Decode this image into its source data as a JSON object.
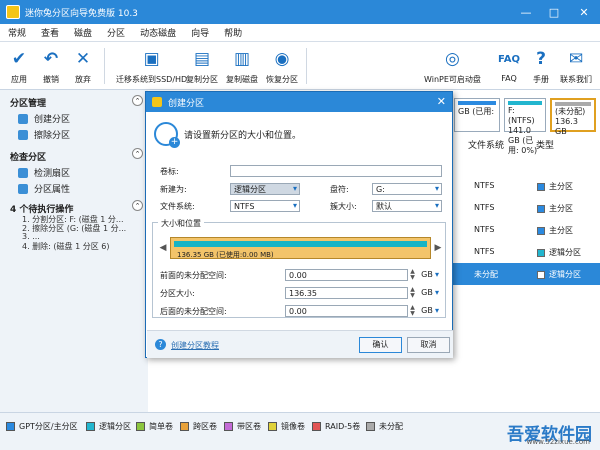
{
  "window": {
    "title": "迷你兔分区向导免费版 10.3",
    "minimize": "—",
    "maximize": "□",
    "close": "✕"
  },
  "menu": [
    "常规",
    "查看",
    "磁盘",
    "分区",
    "动态磁盘",
    "向导",
    "帮助"
  ],
  "toolbar": {
    "apply": "应用",
    "undo": "撤销",
    "discard": "放弃",
    "migrate": "迁移系统到SSD/HD",
    "copy_partition": "复制分区",
    "copy_disk": "复制磁盘",
    "recover_partition": "恢复分区",
    "winpe": "WinPE可启动盘",
    "faq": "FAQ",
    "manual": "手册",
    "contact": "联系我们"
  },
  "sidebar": {
    "partition_mgmt": "分区管理",
    "create_partition": "创建分区",
    "delete_partition": "擦除分区",
    "check_partition": "检查分区",
    "check_bad_sectors": "检测扇区",
    "partition_props": "分区属性",
    "pending": "4 个待执行操作",
    "ops": [
      "1. 分割分区: F: (磁盘 1 分...",
      "2. 擦除分区 (G: (磁盘 1 分...",
      "3. ...",
      "4. 删除: (磁盘 1 分区 6)"
    ]
  },
  "disk_map": {
    "f_label": "F: (NTFS)",
    "f_size": "141.0 GB (已用:",
    "f_used": "0%)",
    "un_label": "(未分配)",
    "un_size": "136.3 GB",
    "left_fragment": "GB (已用:"
  },
  "columns": {
    "fs": "文件系统",
    "type": "类型"
  },
  "rows": [
    {
      "fs": "NTFS",
      "type": "主分区",
      "color": "#2b8ae0"
    },
    {
      "fs": "NTFS",
      "type": "主分区",
      "color": "#2b8ae0"
    },
    {
      "fs": "NTFS",
      "type": "主分区",
      "color": "#2b8ae0"
    },
    {
      "fs": "NTFS",
      "type": "逻辑分区",
      "color": "#22b6cf"
    },
    {
      "fs": "未分配",
      "type": "逻辑分区",
      "color": "#2b8ae0"
    }
  ],
  "dialog": {
    "title": "创建分区",
    "heading": "请设置新分区的大小和位置。",
    "volume_label": "卷标:",
    "create_as": "新建为:",
    "create_as_value": "逻辑分区",
    "drive_letter": "盘符:",
    "drive_letter_value": "G:",
    "file_system": "文件系统:",
    "file_system_value": "NTFS",
    "cluster_size": "簇大小:",
    "cluster_size_value": "默认",
    "size_location": "大小和位置",
    "bar_text": "136.35 GB (已使用:0.00 MB)",
    "before_label": "前面的未分配空间:",
    "before_value": "0.00",
    "size_label": "分区大小:",
    "size_value": "136.35",
    "after_label": "后面的未分配空间:",
    "after_value": "0.00",
    "unit": "GB",
    "help_link": "创建分区教程",
    "ok": "确认",
    "cancel": "取消"
  },
  "legend": [
    "GPT分区/主分区",
    "逻辑分区",
    "简单卷",
    "跨区卷",
    "带区卷",
    "镜像卷",
    "RAID-5卷",
    "未分配"
  ],
  "legend_colors": [
    "#2b8ae0",
    "#22b6cf",
    "#8cc63f",
    "#e8a23a",
    "#c36bd6",
    "#e0d23a",
    "#e25555",
    "#aaaaaa"
  ],
  "watermark": {
    "brand": "吾爱软件园",
    "url": "www.52zixue.com"
  }
}
